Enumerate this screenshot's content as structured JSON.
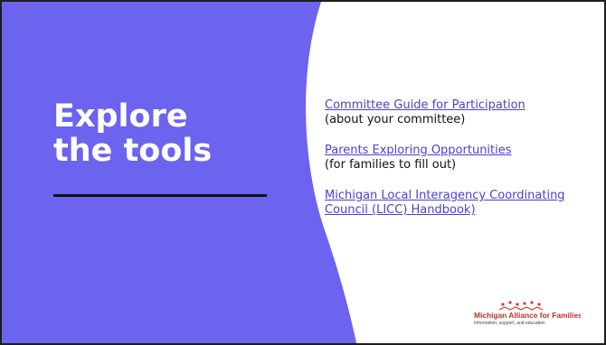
{
  "slide": {
    "title": "Explore\nthe tools",
    "accent_color": "#6c63ee",
    "link_color": "#4a3fd6"
  },
  "resources": [
    {
      "link_text": "Committee Guide for Participation",
      "note": "(about your committee)"
    },
    {
      "link_text": "Parents Exploring Opportunities",
      "note": "(for families to fill out)"
    },
    {
      "link_text": "Michigan Local Interagency Coordinating Council (LICC) Handbook)",
      "note": ""
    }
  ],
  "logo": {
    "name": "Michigan Alliance for Families",
    "tagline": "Information, support, and education"
  }
}
